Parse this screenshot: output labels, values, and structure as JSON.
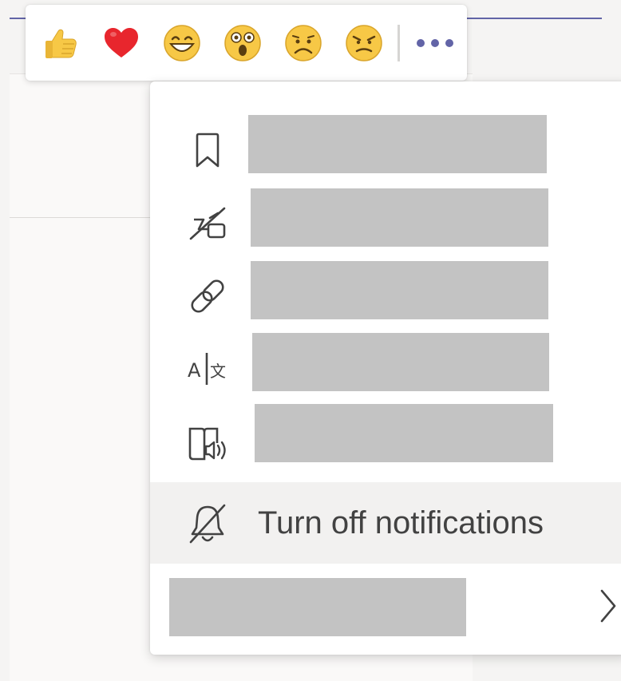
{
  "reactions": [
    {
      "name": "like",
      "icon": "thumbs-up-icon"
    },
    {
      "name": "heart",
      "icon": "heart-icon"
    },
    {
      "name": "laugh",
      "icon": "laughing-face-icon"
    },
    {
      "name": "surprised",
      "icon": "surprised-face-icon"
    },
    {
      "name": "sad",
      "icon": "sad-face-icon"
    },
    {
      "name": "angry",
      "icon": "angry-face-icon"
    }
  ],
  "more_options_icon": "more-horizontal-icon",
  "menu": {
    "items": [
      {
        "icon": "bookmark-icon",
        "label": ""
      },
      {
        "icon": "mark-unread-icon",
        "label": ""
      },
      {
        "icon": "link-icon",
        "label": ""
      },
      {
        "icon": "translate-icon",
        "label": ""
      },
      {
        "icon": "immersive-reader-icon",
        "label": ""
      },
      {
        "icon": "bell-off-icon",
        "label": "Turn off notifications"
      },
      {
        "icon": "chevron-right-icon",
        "label": ""
      }
    ]
  },
  "colors": {
    "accent": "#6264a7",
    "redaction": "#c3c3c3",
    "highlight": "#f2f1f0",
    "emoji_yellow": "#f7c846",
    "heart_red": "#e8262d"
  }
}
